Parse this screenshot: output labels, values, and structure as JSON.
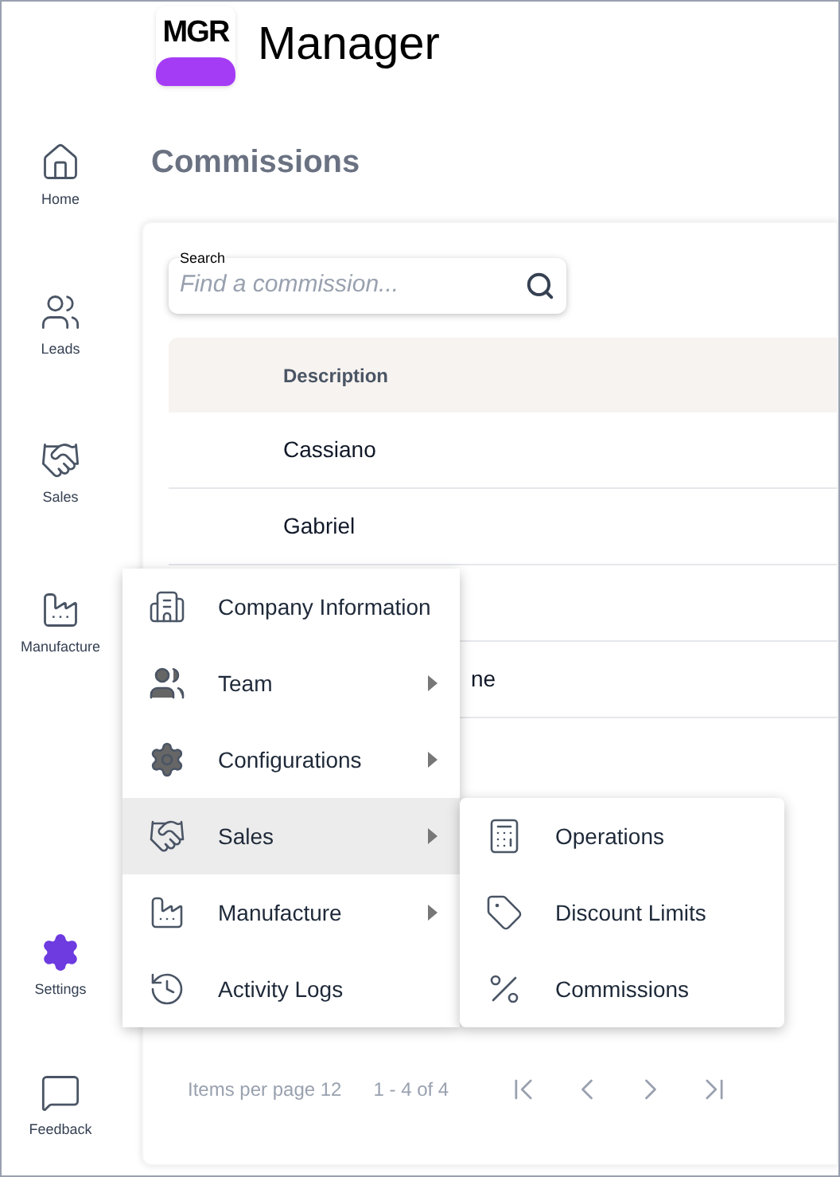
{
  "logo": {
    "mark": "MGR",
    "name": "Manager"
  },
  "sidebar": {
    "items": [
      {
        "kind": "home",
        "label": "Home",
        "selected": false
      },
      {
        "kind": "leads",
        "label": "Leads",
        "selected": false
      },
      {
        "kind": "sales",
        "label": "Sales",
        "selected": false
      },
      {
        "kind": "manufacture",
        "label": "Manufacture",
        "selected": false
      }
    ],
    "bottom_items": [
      {
        "kind": "settings",
        "label": "Settings",
        "selected": true
      },
      {
        "kind": "feedback",
        "label": "Feedback",
        "selected": false
      }
    ]
  },
  "page_title": "Commissions",
  "search": {
    "label": "Search",
    "placeholder": "Find a commission..."
  },
  "table": {
    "columns": [
      "Description"
    ],
    "rows": [
      {
        "description": "Cassiano",
        "covered": false
      },
      {
        "description": "Gabriel",
        "covered": false
      },
      {},
      {
        "description": "ne",
        "covered": true
      }
    ]
  },
  "pagination": {
    "items_per_page": "Items per page 12",
    "range": "1 - 4 of 4"
  },
  "menu": {
    "items": [
      {
        "kind": "building",
        "label": "Company Information",
        "submenu": false,
        "selected": false
      },
      {
        "kind": "team",
        "label": "Team",
        "submenu": true,
        "selected": false
      },
      {
        "kind": "gear",
        "label": "Configurations",
        "submenu": true,
        "selected": false
      },
      {
        "kind": "sales",
        "label": "Sales",
        "submenu": true,
        "selected": true
      },
      {
        "kind": "manufacture",
        "label": "Manufacture",
        "submenu": true,
        "selected": false
      },
      {
        "kind": "history",
        "label": "Activity Logs",
        "submenu": false,
        "selected": false
      }
    ],
    "submenu": [
      {
        "kind": "calculator",
        "label": "Operations"
      },
      {
        "kind": "tag",
        "label": "Discount Limits"
      },
      {
        "kind": "percent",
        "label": "Commissions"
      }
    ]
  }
}
